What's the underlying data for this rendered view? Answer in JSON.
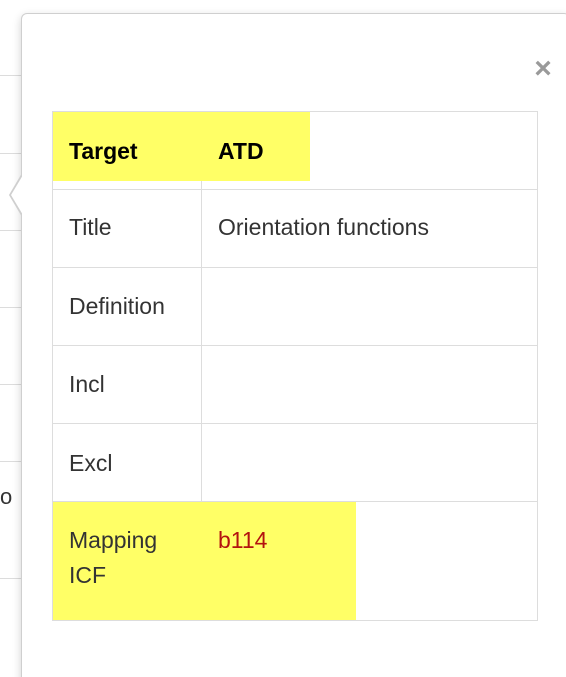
{
  "background": {
    "cut_text": "o"
  },
  "popover": {
    "close_label": "×",
    "rows": [
      {
        "key": "Target",
        "value": "ATD"
      },
      {
        "key": "Title",
        "value": "Orientation functions"
      },
      {
        "key": "Definition",
        "value": ""
      },
      {
        "key": "Incl",
        "value": ""
      },
      {
        "key": "Excl",
        "value": ""
      },
      {
        "key_line1": "Mapping",
        "key_line2": "ICF",
        "value": "b114"
      }
    ]
  },
  "colors": {
    "highlight": "#ffff66",
    "link": "#b3120f",
    "border": "#dddddd",
    "close_icon": "#9a9a9a"
  }
}
